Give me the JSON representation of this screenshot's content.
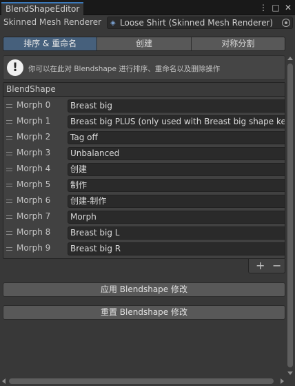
{
  "window": {
    "tab_title": "BlendShapeEditor",
    "icons": [
      "more-options-icon",
      "maximize-icon",
      "close-icon"
    ]
  },
  "mesh_field": {
    "label": "Skinned Mesh Renderer",
    "value": "Loose Shirt (Skinned Mesh Renderer)"
  },
  "toolbar": {
    "tabs": [
      {
        "label": "排序 & 重命名",
        "active": true
      },
      {
        "label": "创建",
        "active": false
      },
      {
        "label": "对称分割",
        "active": false
      }
    ]
  },
  "help": {
    "text": "你可以在此对 Blendshape 进行排序、重命名以及删除操作"
  },
  "list": {
    "header": "BlendShape",
    "rows": [
      {
        "label": "Morph 0",
        "value": "Breast big"
      },
      {
        "label": "Morph 1",
        "value": "Breast big PLUS (only used with Breast big shape key"
      },
      {
        "label": "Morph 2",
        "value": "Tag off"
      },
      {
        "label": "Morph 3",
        "value": "Unbalanced"
      },
      {
        "label": "Morph 4",
        "value": "创建"
      },
      {
        "label": "Morph 5",
        "value": "制作"
      },
      {
        "label": "Morph 6",
        "value": "创建-制作"
      },
      {
        "label": "Morph 7",
        "value": "Morph"
      },
      {
        "label": "Morph 8",
        "value": "Breast big L"
      },
      {
        "label": "Morph 9",
        "value": "Breast big R"
      }
    ],
    "add_label": "+",
    "remove_label": "−"
  },
  "actions": {
    "apply_label": "应用 Blendshape 修改",
    "reset_label": "重置 Blendshape 修改"
  },
  "colors": {
    "background": "#383838",
    "active_tab": "#46607c",
    "accent": "#3a79bb"
  }
}
